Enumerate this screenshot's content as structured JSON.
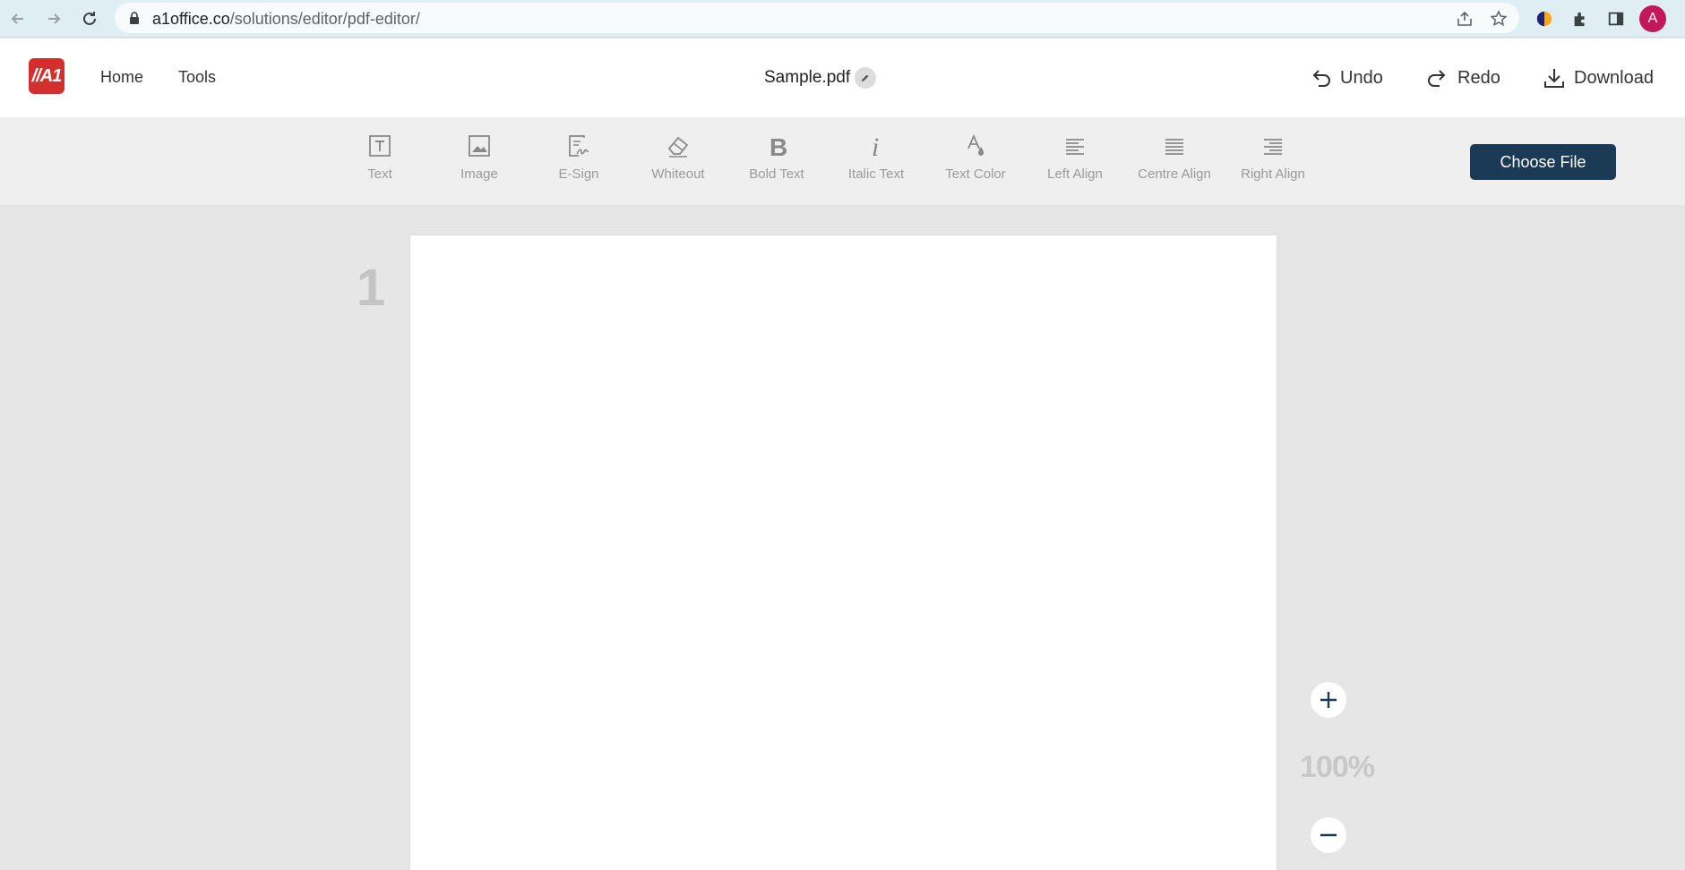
{
  "browser": {
    "url_host": "a1office.co",
    "url_path": "/solutions/editor/pdf-editor/",
    "avatar_letter": "A"
  },
  "header": {
    "logo_text": "//A1",
    "nav": [
      {
        "label": "Home"
      },
      {
        "label": "Tools"
      }
    ],
    "document_title": "Sample.pdf",
    "undo_label": "Undo",
    "redo_label": "Redo",
    "download_label": "Download"
  },
  "toolbar": {
    "tools": [
      {
        "label": "Text",
        "icon": "text-box-icon"
      },
      {
        "label": "Image",
        "icon": "image-icon"
      },
      {
        "label": "E-Sign",
        "icon": "signature-icon"
      },
      {
        "label": "Whiteout",
        "icon": "eraser-icon"
      },
      {
        "label": "Bold Text",
        "icon": "bold-icon"
      },
      {
        "label": "Italic Text",
        "icon": "italic-icon"
      },
      {
        "label": "Text Color",
        "icon": "text-color-icon"
      },
      {
        "label": "Left Align",
        "icon": "align-left-icon"
      },
      {
        "label": "Centre Align",
        "icon": "align-center-icon"
      },
      {
        "label": "Right Align",
        "icon": "align-right-icon"
      }
    ],
    "choose_file_label": "Choose File"
  },
  "workspace": {
    "page_number": "1",
    "zoom_level": "100%"
  },
  "colors": {
    "primary_button": "#1a3a56",
    "logo": "#d32f2f",
    "avatar": "#c2185b"
  }
}
